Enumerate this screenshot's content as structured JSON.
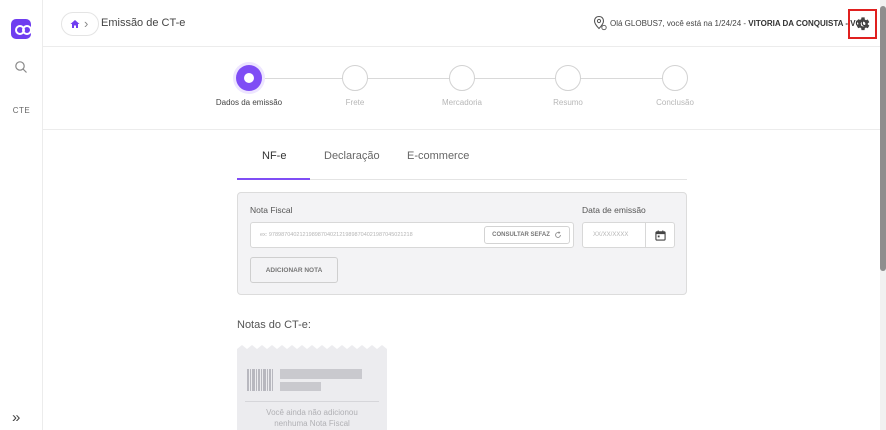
{
  "sidebar": {
    "logo_icon": "logo-icon",
    "search_icon": "search-icon",
    "nav_item_cte": "CTE",
    "expand_icon": "»"
  },
  "header": {
    "home_icon": "home-icon",
    "page_title": "Emissão de CT-e",
    "greeting_prefix": "Olá GLOBUS7, você está na 1/24/24 - ",
    "greeting_location": "VITORIA DA CONQUISTA - VCO",
    "settings_icon": "gear-icon"
  },
  "stepper": {
    "steps": [
      {
        "label": "Dados da emissão",
        "active": true
      },
      {
        "label": "Frete",
        "active": false
      },
      {
        "label": "Mercadoria",
        "active": false
      },
      {
        "label": "Resumo",
        "active": false
      },
      {
        "label": "Conclusão",
        "active": false
      }
    ]
  },
  "tabs": [
    {
      "label": "NF-e",
      "active": true
    },
    {
      "label": "Declaração",
      "active": false
    },
    {
      "label": "E-commerce",
      "active": false
    }
  ],
  "form": {
    "nota_fiscal_label": "Nota Fiscal",
    "nota_fiscal_placeholder": "ex: 97898704021219898704021219898704021987045021218",
    "consultar_sefaz_label": "CONSULTAR SEFAZ",
    "data_emissao_label": "Data de emissão",
    "data_emissao_placeholder": "XX/XX/XXXX",
    "adicionar_nota_label": "ADICIONAR NOTA"
  },
  "notes": {
    "title": "Notas do CT-e:",
    "empty_line1": "Você ainda não adicionou",
    "empty_line2": "nenhuma Nota Fiscal"
  },
  "colors": {
    "accent": "#7f4df5",
    "highlight_border": "#e0201f"
  }
}
